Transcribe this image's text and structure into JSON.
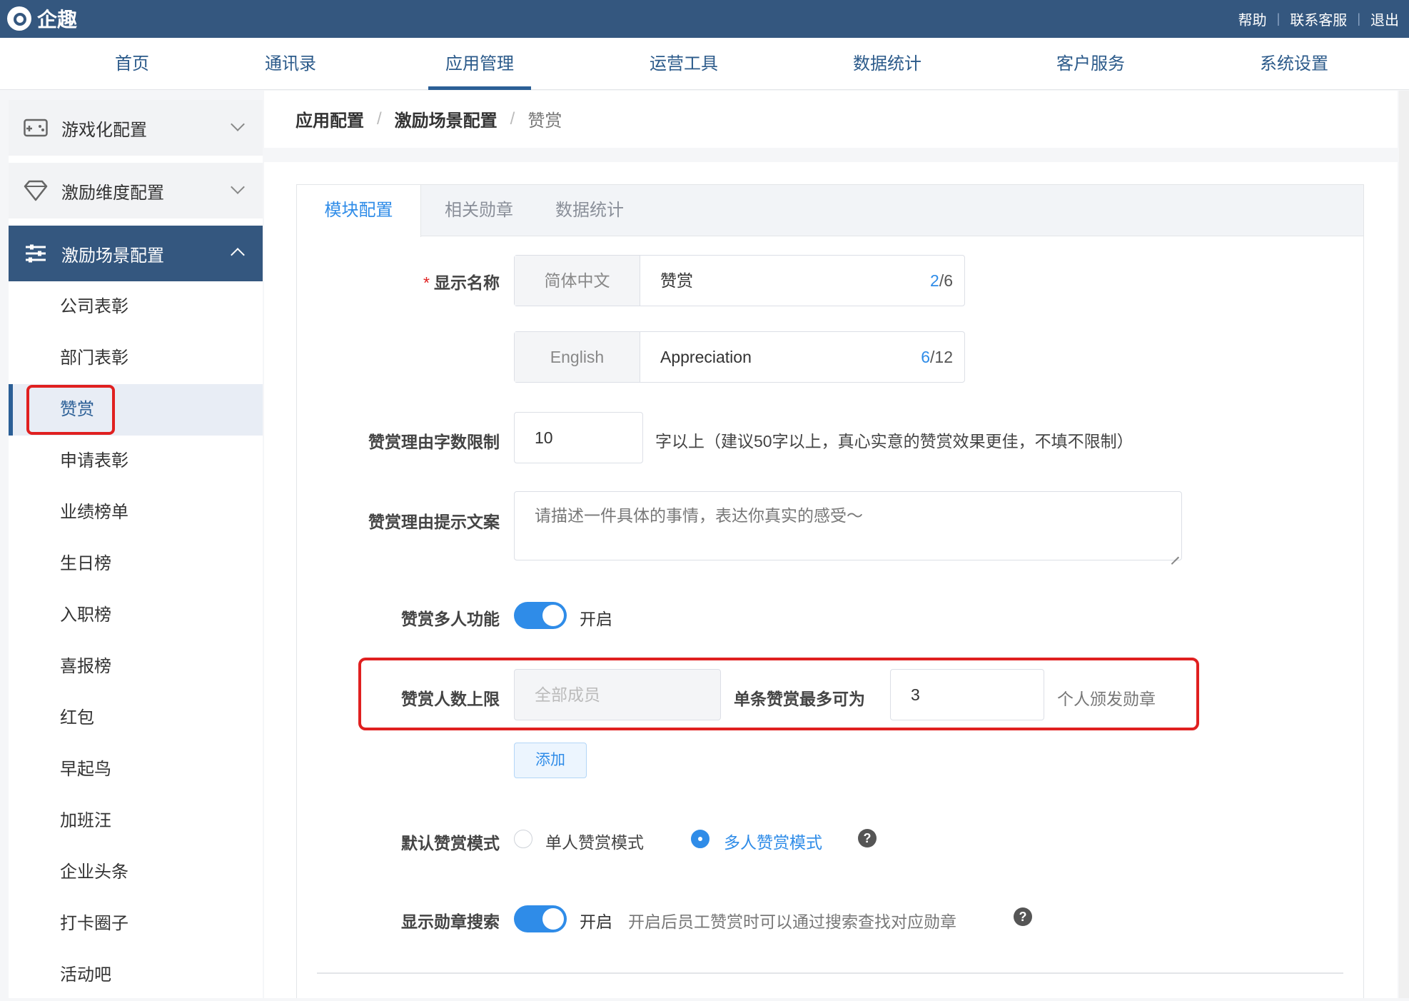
{
  "topbar": {
    "logo_text": "企趣",
    "links": [
      "帮助",
      "联系客服",
      "退出"
    ]
  },
  "nav": {
    "items": [
      "首页",
      "通讯录",
      "应用管理",
      "运营工具",
      "数据统计",
      "客户服务",
      "系统设置"
    ],
    "active": "应用管理"
  },
  "sidebar": {
    "groups": [
      {
        "label": "游戏化配置",
        "icon": "gamepad-icon"
      },
      {
        "label": "激励维度配置",
        "icon": "diamond-icon"
      },
      {
        "label": "激励场景配置",
        "icon": "sliders-icon"
      }
    ],
    "subitems": [
      "公司表彰",
      "部门表彰",
      "赞赏",
      "申请表彰",
      "业绩榜单",
      "生日榜",
      "入职榜",
      "喜报榜",
      "红包",
      "早起鸟",
      "加班汪",
      "企业头条",
      "打卡圈子",
      "活动吧"
    ],
    "active_sub": "赞赏"
  },
  "breadcrumb": [
    "应用配置",
    "激励场景配置",
    "赞赏"
  ],
  "tabs": [
    "模块配置",
    "相关勋章",
    "数据统计"
  ],
  "form": {
    "display_name": {
      "label": "显示名称",
      "required_mark": "*",
      "zh": {
        "lang": "简体中文",
        "value": "赞赏",
        "count_cur": "2",
        "count_max": "/6"
      },
      "en": {
        "lang": "English",
        "value": "Appreciation",
        "count_cur": "6",
        "count_max": "/12"
      }
    },
    "reason_limit": {
      "label": "赞赏理由字数限制",
      "value": "10",
      "note": "字以上（建议50字以上，真心实意的赞赏效果更佳，不填不限制）"
    },
    "reason_hint": {
      "label": "赞赏理由提示文案",
      "value": "请描述一件具体的事情，表达你真实的感受～"
    },
    "multi": {
      "label": "赞赏多人功能",
      "state": "开启",
      "enabled": true
    },
    "limit": {
      "label": "赞赏人数上限",
      "scope_placeholder": "全部成员",
      "mid_label": "单条赞赏最多可为",
      "value": "3",
      "suffix": "个人颁发勋章"
    },
    "add_button": "添加",
    "default_mode": {
      "label": "默认赞赏模式",
      "options": [
        "单人赞赏模式",
        "多人赞赏模式"
      ],
      "selected": "多人赞赏模式"
    },
    "badge_search": {
      "label": "显示勋章搜索",
      "state": "开启",
      "enabled": true,
      "note": "开启后员工赞赏时可以通过搜索查找对应勋章"
    },
    "help_glyph": "?"
  },
  "colors": {
    "primary": "#2f8ce8",
    "header_bg": "#34577f",
    "highlight": "#e02020"
  }
}
